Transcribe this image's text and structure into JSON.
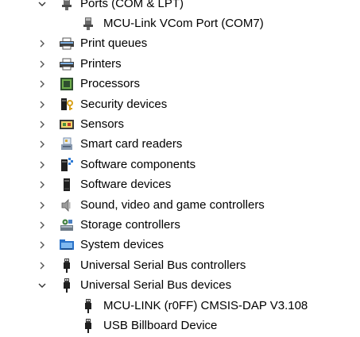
{
  "tree": {
    "items": [
      {
        "label": "Ports (COM & LPT)",
        "icon": "port-icon",
        "expanded": true
      },
      {
        "label": "MCU-Link VCom Port (COM7)",
        "icon": "port-device-icon",
        "child": true
      },
      {
        "label": "Print queues",
        "icon": "printer-icon"
      },
      {
        "label": "Printers",
        "icon": "printer-icon"
      },
      {
        "label": "Processors",
        "icon": "processor-icon"
      },
      {
        "label": "Security devices",
        "icon": "security-key-icon"
      },
      {
        "label": "Sensors",
        "icon": "sensor-icon"
      },
      {
        "label": "Smart card readers",
        "icon": "smart-card-reader-icon"
      },
      {
        "label": "Software components",
        "icon": "software-component-icon"
      },
      {
        "label": "Software devices",
        "icon": "software-device-icon"
      },
      {
        "label": "Sound, video and game controllers",
        "icon": "speaker-icon"
      },
      {
        "label": "Storage controllers",
        "icon": "storage-controller-icon"
      },
      {
        "label": "System devices",
        "icon": "system-folder-icon"
      },
      {
        "label": "Universal Serial Bus controllers",
        "icon": "usb-icon"
      },
      {
        "label": "Universal Serial Bus devices",
        "icon": "usb-icon",
        "expanded": true
      },
      {
        "label": "MCU-LINK (r0FF) CMSIS-DAP V3.108",
        "icon": "usb-device-icon",
        "child": true
      },
      {
        "label": "USB Billboard Device",
        "icon": "usb-device-icon",
        "child": true
      }
    ]
  }
}
